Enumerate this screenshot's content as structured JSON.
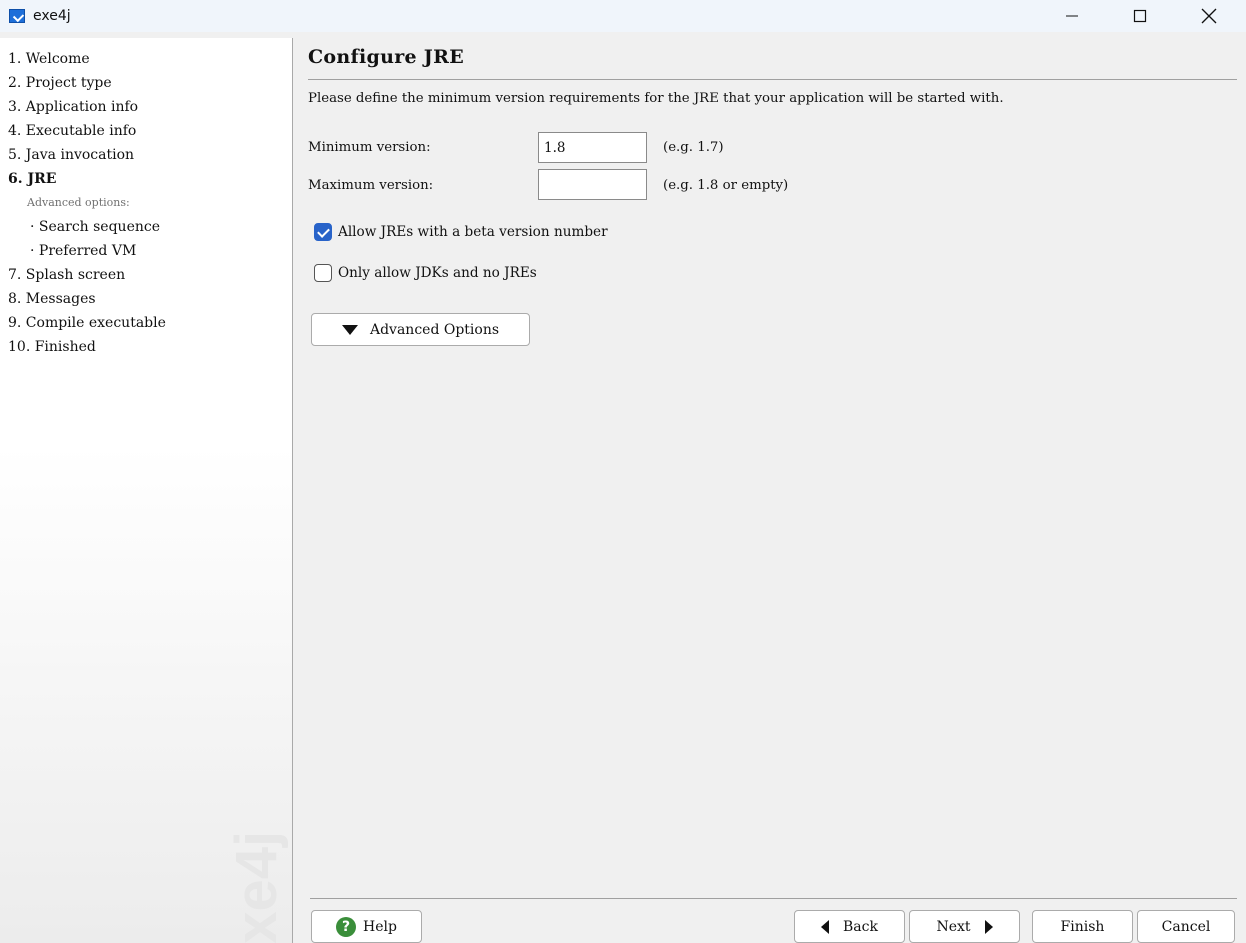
{
  "window": {
    "title": "exe4j"
  },
  "sidebar": {
    "items": [
      {
        "label": "1. Welcome"
      },
      {
        "label": "2. Project type"
      },
      {
        "label": "3. Application info"
      },
      {
        "label": "4. Executable info"
      },
      {
        "label": "5. Java invocation"
      },
      {
        "label": "6. JRE"
      }
    ],
    "advanced_heading": "Advanced options:",
    "sub_items": [
      {
        "label": "· Search sequence"
      },
      {
        "label": "· Preferred VM"
      }
    ],
    "items_after": [
      {
        "label": "7. Splash screen"
      },
      {
        "label": "8. Messages"
      },
      {
        "label": "9. Compile executable"
      },
      {
        "label": "10. Finished"
      }
    ],
    "watermark": "exe4j"
  },
  "main": {
    "title": "Configure JRE",
    "description": "Please define the minimum version requirements for the JRE that your application will be started with.",
    "min_version": {
      "label": "Minimum version:",
      "value": "1.8",
      "hint": "(e.g. 1.7)"
    },
    "max_version": {
      "label": "Maximum version:",
      "value": "",
      "hint": "(e.g. 1.8 or empty)"
    },
    "allow_beta": {
      "label": "Allow JREs with a beta version number",
      "checked": true
    },
    "only_jdks": {
      "label": "Only allow JDKs and no JREs",
      "checked": false
    },
    "advanced_options_label": "Advanced Options"
  },
  "footer": {
    "help_label": "Help",
    "back_label": "Back",
    "next_label": "Next",
    "finish_label": "Finish",
    "cancel_label": "Cancel"
  },
  "colors": {
    "accent": "#2863c9",
    "help_icon": "#3a8e3a"
  }
}
